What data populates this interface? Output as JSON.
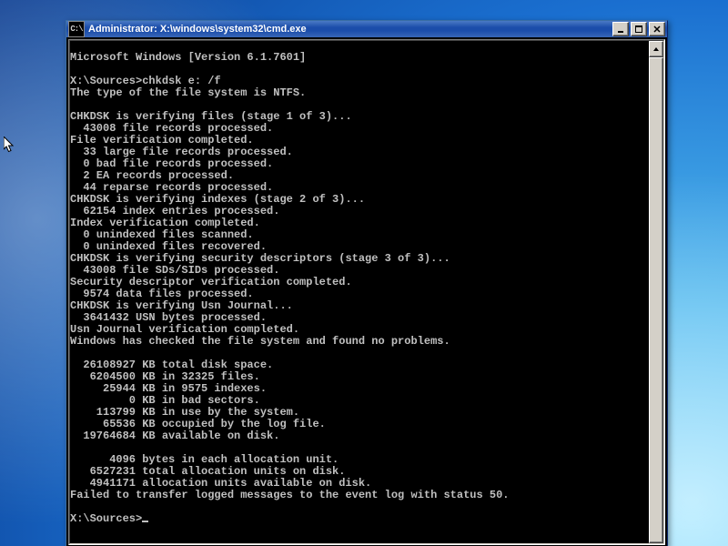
{
  "window": {
    "title": "Administrator: X:\\windows\\system32\\cmd.exe",
    "icon_text": "C:\\"
  },
  "console": {
    "version_line": "Microsoft Windows [Version 6.1.7601]",
    "prompt1": "X:\\Sources>",
    "command": "chkdsk e: /f",
    "lines": [
      "The type of the file system is NTFS.",
      "",
      "CHKDSK is verifying files (stage 1 of 3)...",
      "  43008 file records processed.",
      "File verification completed.",
      "  33 large file records processed.",
      "  0 bad file records processed.",
      "  2 EA records processed.",
      "  44 reparse records processed.",
      "CHKDSK is verifying indexes (stage 2 of 3)...",
      "  62154 index entries processed.",
      "Index verification completed.",
      "  0 unindexed files scanned.",
      "  0 unindexed files recovered.",
      "CHKDSK is verifying security descriptors (stage 3 of 3)...",
      "  43008 file SDs/SIDs processed.",
      "Security descriptor verification completed.",
      "  9574 data files processed.",
      "CHKDSK is verifying Usn Journal...",
      "  3641432 USN bytes processed.",
      "Usn Journal verification completed.",
      "Windows has checked the file system and found no problems.",
      "",
      "  26108927 KB total disk space.",
      "   6204500 KB in 32325 files.",
      "     25944 KB in 9575 indexes.",
      "         0 KB in bad sectors.",
      "    113799 KB in use by the system.",
      "     65536 KB occupied by the log file.",
      "  19764684 KB available on disk.",
      "",
      "      4096 bytes in each allocation unit.",
      "   6527231 total allocation units on disk.",
      "   4941171 allocation units available on disk.",
      "Failed to transfer logged messages to the event log with status 50.",
      ""
    ],
    "prompt2": "X:\\Sources>"
  }
}
